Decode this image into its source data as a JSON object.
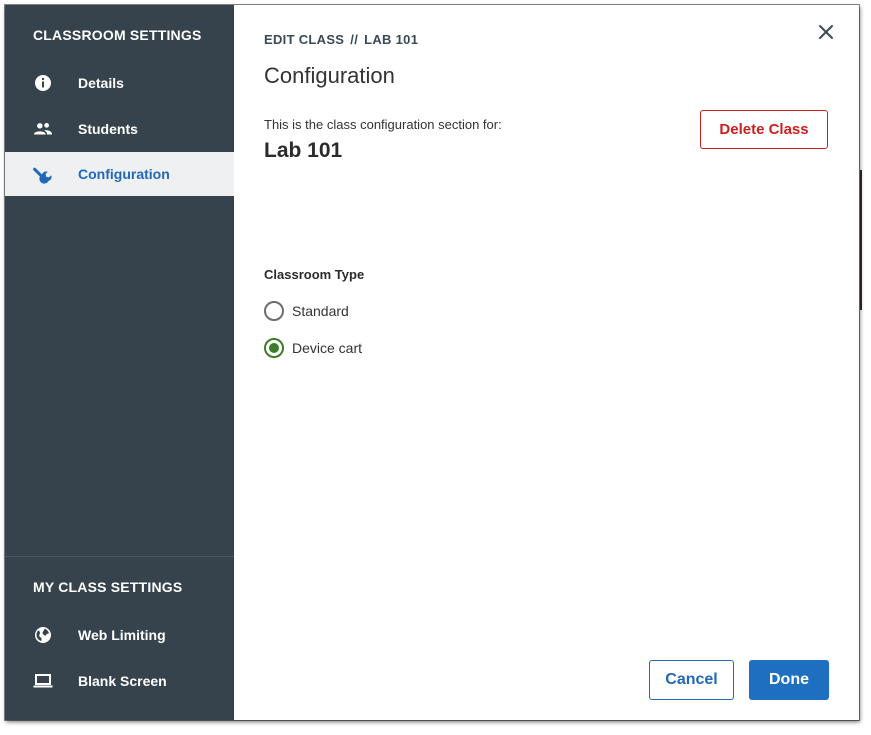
{
  "sidebar": {
    "classroom_settings_title": "CLASSROOM SETTINGS",
    "classroom_items": [
      {
        "label": "Details",
        "icon": "info-icon"
      },
      {
        "label": "Students",
        "icon": "people-icon"
      },
      {
        "label": "Configuration",
        "icon": "wrench-icon",
        "active": true
      }
    ],
    "my_class_settings_title": "MY CLASS SETTINGS",
    "my_class_items": [
      {
        "label": "Web Limiting",
        "icon": "globe-icon"
      },
      {
        "label": "Blank Screen",
        "icon": "laptop-icon"
      }
    ]
  },
  "main": {
    "breadcrumb": {
      "part1": "EDIT CLASS",
      "separator": "//",
      "part2": "LAB 101"
    },
    "title": "Configuration",
    "intro_text": "This is the class configuration section for:",
    "class_name": "Lab 101",
    "delete_label": "Delete Class",
    "classroom_type": {
      "heading": "Classroom Type",
      "options": [
        {
          "label": "Standard",
          "selected": false
        },
        {
          "label": "Device cart",
          "selected": true
        }
      ]
    },
    "cancel_label": "Cancel",
    "done_label": "Done",
    "close_icon": "close-icon"
  },
  "colors": {
    "sidebar_bg": "#36434c",
    "active_item_bg": "#eef0f1",
    "accent_blue": "#1f6fc1",
    "danger_red": "#cc1f1f",
    "radio_green": "#3c7d2a"
  }
}
